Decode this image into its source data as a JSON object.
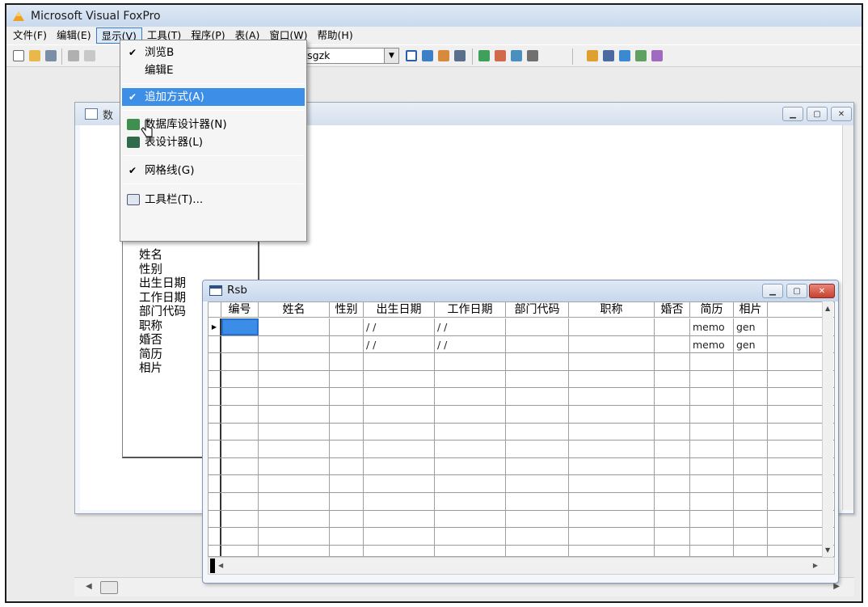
{
  "window": {
    "title": "Microsoft Visual FoxPro"
  },
  "menubar": [
    "文件(F)",
    "编辑(E)",
    "显示(V)",
    "工具(T)",
    "程序(P)",
    "表(A)",
    "窗口(W)",
    "帮助(H)"
  ],
  "toolbar": {
    "combo_value": "rsgzk"
  },
  "db_window": {
    "title": "数"
  },
  "dropdown": {
    "items": [
      {
        "label": "浏览B",
        "checked": true
      },
      {
        "label": "编辑E",
        "checked": false
      },
      {
        "label": "追加方式(A)",
        "checked": true
      },
      {
        "label": "数据库设计器(N)"
      },
      {
        "label": "表设计器(L)"
      },
      {
        "label": "网格线(G)",
        "checked": true
      },
      {
        "label": "工具栏(T)..."
      }
    ]
  },
  "field_list": [
    "姓名",
    "性别",
    "出生日期",
    "工作日期",
    "部门代码",
    "职称",
    "婚否",
    "简历",
    "相片"
  ],
  "rsb": {
    "title": "Rsb",
    "columns": [
      "编号",
      "姓名",
      "性别",
      "出生日期",
      "工作日期",
      "部门代码",
      "职称",
      "婚否",
      "简历",
      "相片"
    ],
    "rows": [
      [
        "",
        "",
        "",
        "/ /",
        "/ /",
        "",
        "",
        "",
        "memo",
        "gen"
      ],
      [
        "",
        "",
        "",
        "/ /",
        "/ /",
        "",
        "",
        "",
        "memo",
        "gen"
      ]
    ]
  },
  "colors": {
    "accent": "#3d8ee6",
    "titlebar": "#c9d9ee",
    "close": "#c7412f"
  },
  "icons": [
    "foxpro-icon",
    "checkmark-icon",
    "database-designer-icon",
    "table-designer-icon",
    "toolbar-icon",
    "cursor-icon"
  ]
}
